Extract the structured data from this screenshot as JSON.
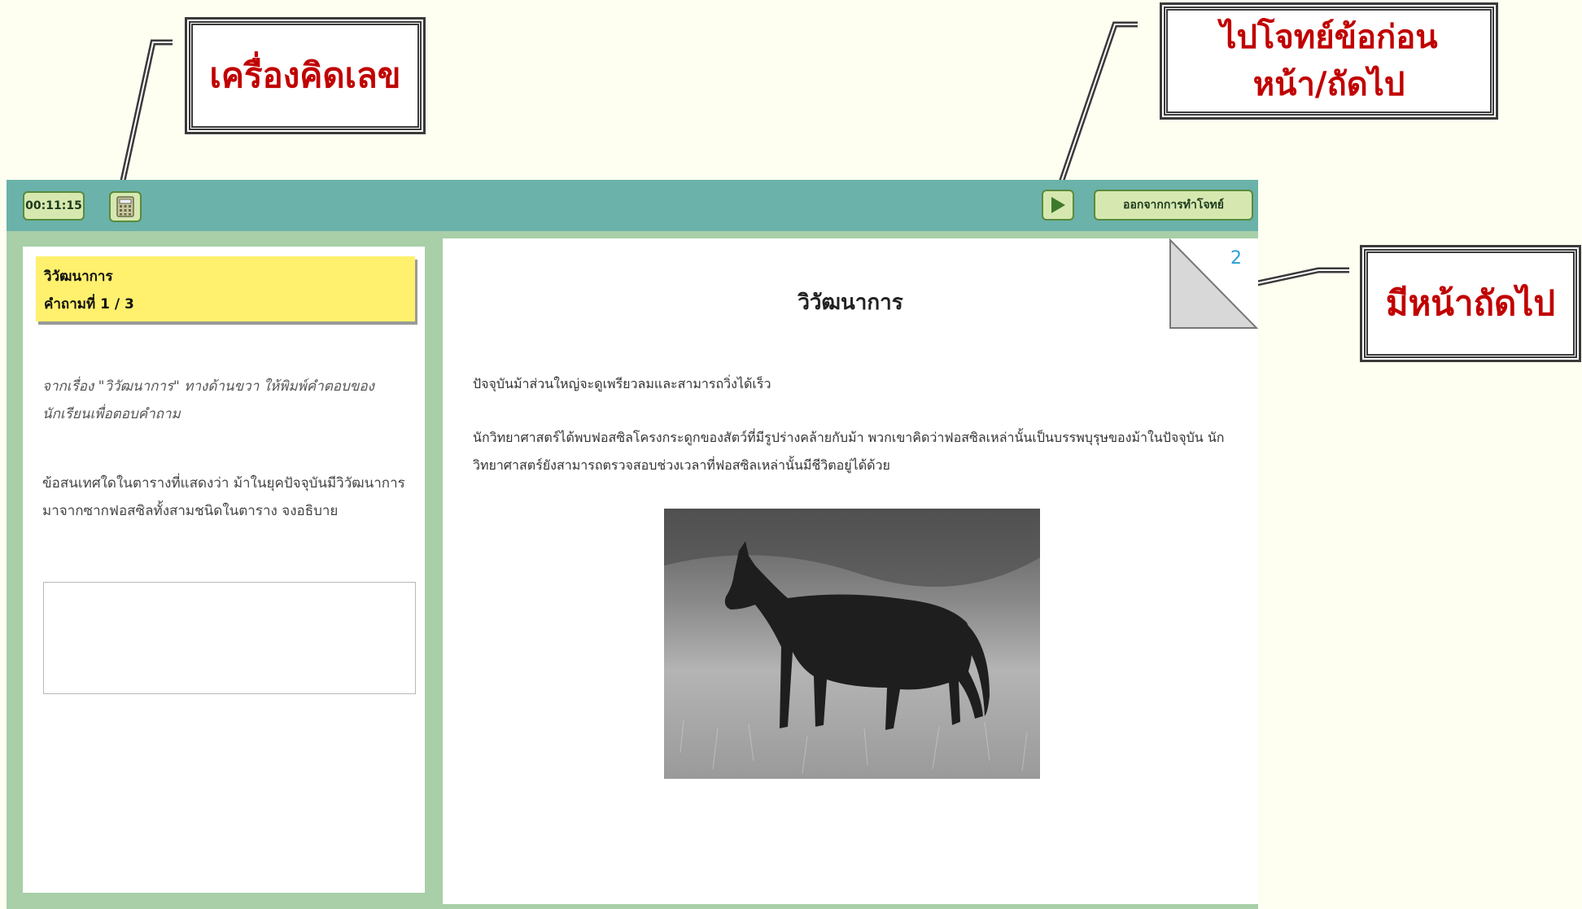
{
  "annotations": {
    "calculator": "เครื่องคิดเลข",
    "navigation_line1": "ไปโจทย์ข้อก่อน",
    "navigation_line2": "หน้า/ถัดไป",
    "next_page": "มีหน้าถัดไป"
  },
  "toolbar": {
    "timer": "00:11:15",
    "calculator_icon": "calculator-icon",
    "next_icon": "play-arrow-icon",
    "exit_label": "ออกจากการทำโจทย์"
  },
  "question": {
    "unit_title": "วิวัฒนาการ",
    "counter": "คำถามที่ 1 / 3",
    "instruction": "จากเรื่อง \"วิวัฒนาการ\" ทางด้านขวา ให้พิมพ์คำตอบของนักเรียนเพื่อตอบคำถาม",
    "text": "ข้อสนเทศใดในตารางที่แสดงว่า ม้าในยุคปัจจุบันมีวิวัฒนาการมาจากซากฟอสซิลทั้งสามชนิดในตาราง จงอธิบาย",
    "answer_value": ""
  },
  "article": {
    "page_number": "2",
    "title": "วิวัฒนาการ",
    "paragraph_1": "ปัจจุบันม้าส่วนใหญ่จะดูเพรียวลมและสามารถวิ่งได้เร็ว",
    "paragraph_2": "นักวิทยาศาสตร์ได้พบฟอสซิลโครงกระดูกของสัตว์ที่มีรูปร่างคล้ายกับม้า พวกเขาคิดว่าฟอสซิลเหล่านั้นเป็นบรรพบุรุษของม้าในปัจจุบัน นักวิทยาศาสตร์ยังสามารถตรวจสอบช่วงเวลาที่ฟอสซิลเหล่านั้นมีชีวิตอยู่ได้ด้วย"
  },
  "colors": {
    "toolbar": "#6ab2aa",
    "frame": "#a8cfa8",
    "question_header": "#fff06e",
    "callout_text": "#c10000",
    "page_number": "#2aa0d8"
  }
}
